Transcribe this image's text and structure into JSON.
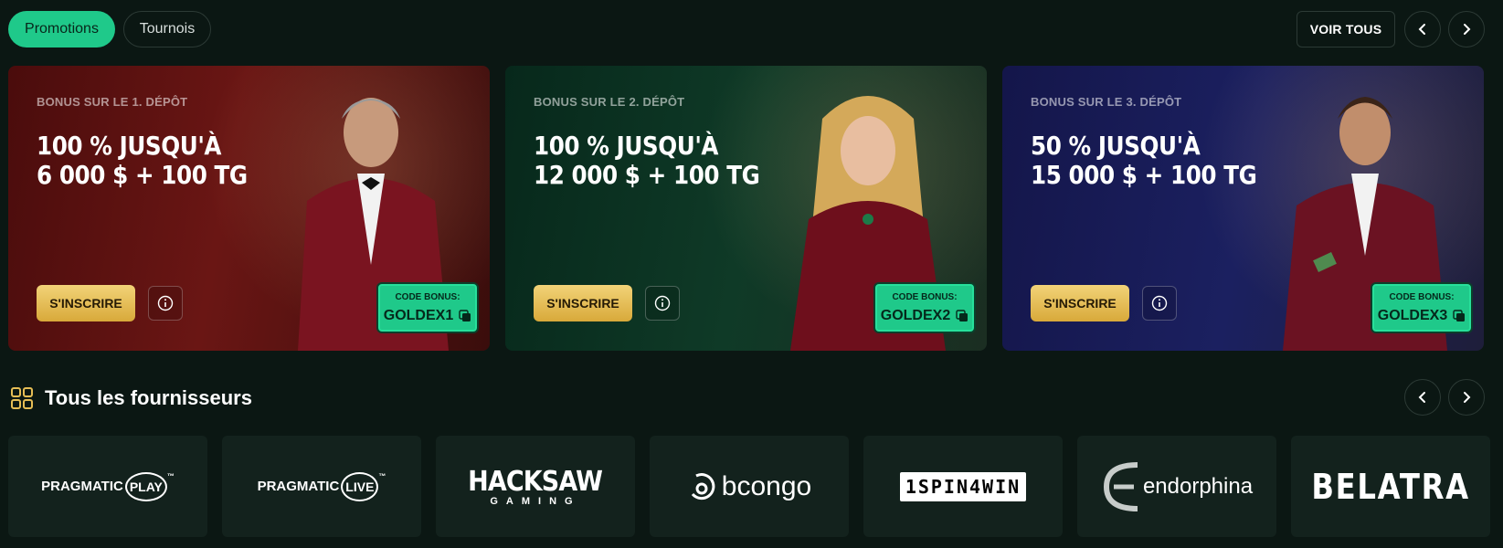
{
  "tabs": [
    {
      "label": "Promotions",
      "active": true
    },
    {
      "label": "Tournois",
      "active": false
    }
  ],
  "header": {
    "view_all": "VOIR TOUS"
  },
  "promos": [
    {
      "pretitle": "BONUS SUR LE 1. DÉPÔT",
      "line1": "100 % JUSQU'À",
      "line2": "6 000 $ + 100 TG",
      "cta": "S'INSCRIRE",
      "code_label": "CODE BONUS:",
      "code": "GOLDEX1"
    },
    {
      "pretitle": "BONUS SUR LE 2. DÉPÔT",
      "line1": "100 % JUSQU'À",
      "line2": "12 000 $ + 100 TG",
      "cta": "S'INSCRIRE",
      "code_label": "CODE BONUS:",
      "code": "GOLDEX2"
    },
    {
      "pretitle": "BONUS SUR LE 3. DÉPÔT",
      "line1": "50 % JUSQU'À",
      "line2": "15 000 $ + 100 TG",
      "cta": "S'INSCRIRE",
      "code_label": "CODE BONUS:",
      "code": "GOLDEX3"
    }
  ],
  "providers_section": {
    "title": "Tous les fournisseurs"
  },
  "providers": [
    {
      "main": "PRAGMATIC",
      "sub": "PLAY",
      "tm": "™"
    },
    {
      "main": "PRAGMATIC",
      "sub": "LIVE",
      "tm": "™"
    },
    {
      "main": "HACKSAW",
      "sub": "GAMING"
    },
    {
      "main": "bcongo"
    },
    {
      "main": "1SPIN4WIN"
    },
    {
      "main": "endorphina"
    },
    {
      "main": "BELATRA"
    }
  ],
  "colors": {
    "accent": "#1fc98a",
    "gold": "#e6bd55",
    "bg": "#0b1713"
  }
}
